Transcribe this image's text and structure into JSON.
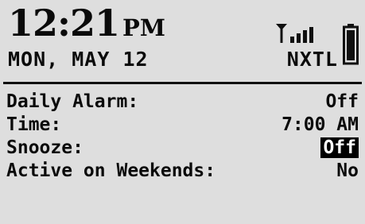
{
  "header": {
    "time": "12:21",
    "ampm": "PM",
    "date": "MON, MAY 12",
    "carrier": "NXTL",
    "signal_icon": "signal-antenna-icon",
    "battery_icon": "battery-icon"
  },
  "alarm_settings": {
    "rows": [
      {
        "label": "Daily Alarm:",
        "value": "Off",
        "selected": false
      },
      {
        "label": "Time:",
        "value": "7:00 AM",
        "selected": false
      },
      {
        "label": "Snooze:",
        "value": "Off",
        "selected": true
      },
      {
        "label": "Active on Weekends:",
        "value": "No",
        "selected": false
      }
    ]
  }
}
